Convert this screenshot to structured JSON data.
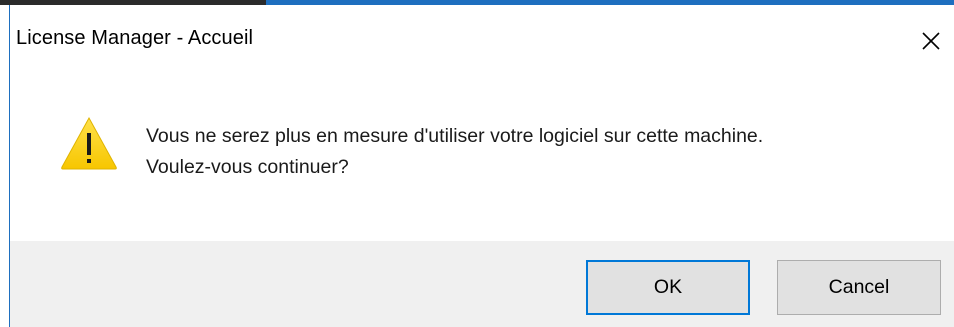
{
  "window": {
    "title": "License Manager - Accueil",
    "close_icon": "close-icon"
  },
  "message": {
    "icon": "warning-icon",
    "line1": "Vous ne serez plus en mesure d'utiliser votre logiciel sur cette machine.",
    "line2": "Voulez-vous continuer?"
  },
  "buttons": {
    "ok_label": "OK",
    "cancel_label": "Cancel"
  },
  "colors": {
    "accent": "#0078d7",
    "warning_fill": "#ffd000",
    "footer_bg": "#f0f0f0"
  }
}
